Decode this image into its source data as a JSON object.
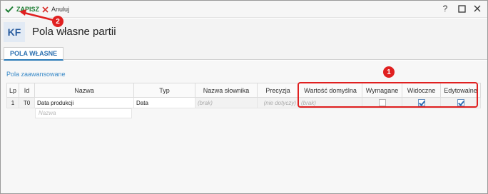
{
  "toolbar": {
    "save_label": "ZAPISZ",
    "cancel_label": "Anuluj",
    "help_glyph": "?",
    "maximize_glyph": "☐",
    "close_glyph": "✕"
  },
  "header": {
    "logo": "KF",
    "title": "Pola własne partii"
  },
  "tabs": [
    {
      "label": "POLA WŁASNE",
      "active": true
    }
  ],
  "section_label": "Pola zaawansowane",
  "grid": {
    "columns": [
      "Lp",
      "Id",
      "Nazwa",
      "Typ",
      "Nazwa słownika",
      "Precyzja",
      "Wartość domyślna",
      "Wymagane",
      "Widoczne",
      "Edytowalne"
    ],
    "rows": [
      {
        "lp": "1",
        "id": "T0",
        "nazwa": "Data produkcji",
        "typ": "Data",
        "nazwa_slownika": "(brak)",
        "precyzja": "(nie dotyczy)",
        "wartosc_domyslna": "(brak)",
        "wymagane": false,
        "widoczne": true,
        "edytowalne": true
      }
    ],
    "new_row_placeholder": "Nazwa"
  },
  "annotations": [
    {
      "number": "1",
      "color": "#e02020"
    },
    {
      "number": "2",
      "color": "#e02020"
    }
  ],
  "colors": {
    "accent": "#2a7ab8",
    "save_green": "#1e7e34",
    "cancel_red": "#d9302c",
    "annotation_red": "#e02020"
  }
}
